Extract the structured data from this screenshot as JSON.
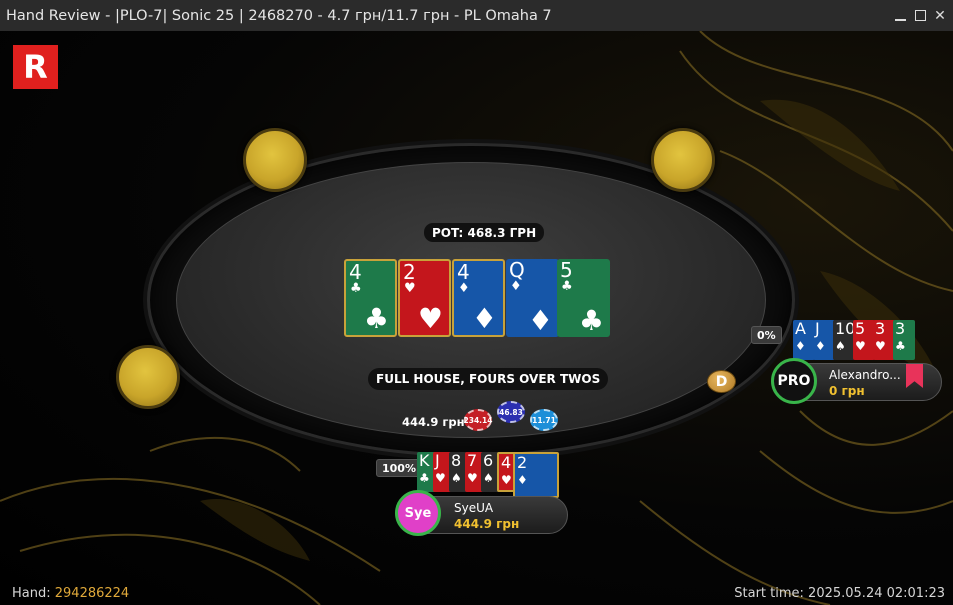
{
  "window": {
    "title": "Hand Review - |PLO-7| Sonic 25 | 2468270 - 4.7 грн/11.7 грн - PL Omaha 7",
    "minimize_icon": "minimize-icon",
    "maximize_icon": "maximize-icon",
    "close_icon": "close-icon"
  },
  "logo": {
    "letter": "R",
    "color": "#e0201e"
  },
  "pot": {
    "label": "POT: 468.3 ГРН"
  },
  "board": [
    {
      "rank": "4",
      "suit": "♣",
      "color": "c"
    },
    {
      "rank": "2",
      "suit": "♥",
      "color": "h"
    },
    {
      "rank": "4",
      "suit": "♦",
      "color": "d"
    },
    {
      "rank": "Q",
      "suit": "♦",
      "color": "d"
    },
    {
      "rank": "5",
      "suit": "♣",
      "color": "c"
    }
  ],
  "hand_result": "FULL HOUSE, FOURS OVER TWOS",
  "bet": {
    "amount": "444.9 грн",
    "chips": [
      "234.14",
      "46.83",
      "11.71"
    ]
  },
  "dealer_button": "D",
  "players": {
    "opponent": {
      "equity": "0%",
      "avatar": "PRO",
      "name": "Alexandro...",
      "stack": "0 грн",
      "cards": [
        {
          "rank": "A",
          "suit": "♦",
          "color": "d"
        },
        {
          "rank": "J",
          "suit": "♦",
          "color": "d"
        },
        {
          "rank": "10",
          "suit": "♠",
          "color": "s"
        },
        {
          "rank": "5",
          "suit": "♥",
          "color": "h"
        },
        {
          "rank": "3",
          "suit": "♥",
          "color": "h"
        },
        {
          "rank": "3",
          "suit": "♣",
          "color": "c"
        }
      ]
    },
    "hero": {
      "equity": "100%",
      "avatar": "Sye",
      "name": "SyeUA",
      "stack": "444.9 грн",
      "cards": [
        {
          "rank": "K",
          "suit": "♣",
          "color": "c"
        },
        {
          "rank": "J",
          "suit": "♥",
          "color": "h"
        },
        {
          "rank": "8",
          "suit": "♠",
          "color": "s"
        },
        {
          "rank": "7",
          "suit": "♥",
          "color": "h"
        },
        {
          "rank": "6",
          "suit": "♠",
          "color": "s"
        },
        {
          "rank": "4",
          "suit": "♥",
          "color": "h"
        },
        {
          "rank": "2",
          "suit": "♦",
          "color": "d"
        }
      ]
    }
  },
  "footer": {
    "hand_label": "Hand:",
    "hand_id": "294286224",
    "start_label": "Start time:",
    "start_time": "2025.05.24 02:01:23"
  }
}
